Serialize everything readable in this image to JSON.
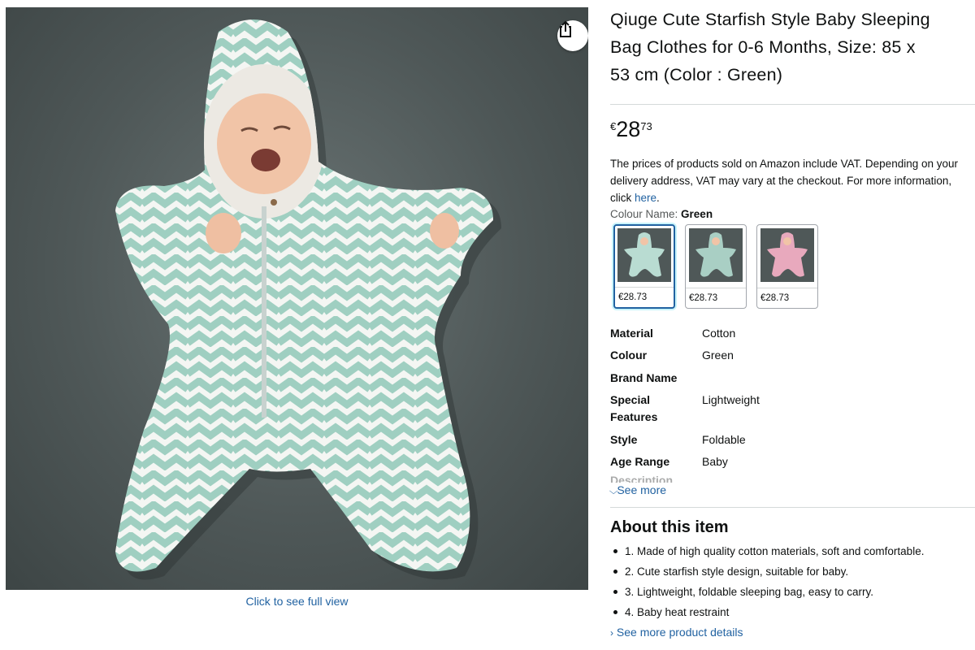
{
  "image": {
    "full_view_label": "Click to see full view",
    "share_icon": "share-icon",
    "pattern_color": "#9fcfc1",
    "background_color": "#4f5858"
  },
  "product": {
    "title": "Qiuge Cute Starfish Style Baby Sleeping\nBag Clothes for 0-6 Months, Size: 85 x\n53 cm (Color : Green)",
    "price": {
      "symbol": "€",
      "whole": "28",
      "fraction": "73"
    },
    "vat_note": "The prices of products sold on Amazon include VAT. Depending on your delivery address, VAT may vary at the checkout. For more information, click",
    "vat_link": "here",
    "vat_end": "."
  },
  "colour": {
    "label": "Colour Name:",
    "selected": "Green",
    "options": [
      {
        "price": "€28.73",
        "color": "#9fcfc1",
        "selected": true
      },
      {
        "price": "€28.73",
        "color": "#9fcfc1",
        "selected": false
      },
      {
        "price": "€28.73",
        "color": "#e8a9bd",
        "selected": false
      }
    ]
  },
  "specs": [
    {
      "key": "Material",
      "value": "Cotton"
    },
    {
      "key": "Colour",
      "value": "Green"
    },
    {
      "key": "Brand Name",
      "value": ""
    },
    {
      "key": "Special\nFeatures",
      "value": "Lightweight"
    },
    {
      "key": "Style",
      "value": "Foldable"
    },
    {
      "key": "Age Range",
      "value": "Baby"
    }
  ],
  "specs_cutoff": "Description",
  "see_more_label": "See more",
  "about": {
    "title": "About this item",
    "bullets": [
      "1. Made of high quality cotton materials, soft and comfortable.",
      "2. Cute starfish style design, suitable for baby.",
      "3. Lightweight, foldable sleeping bag, easy to carry.",
      "4. Baby heat restraint"
    ],
    "see_more_details": "See more product details"
  }
}
